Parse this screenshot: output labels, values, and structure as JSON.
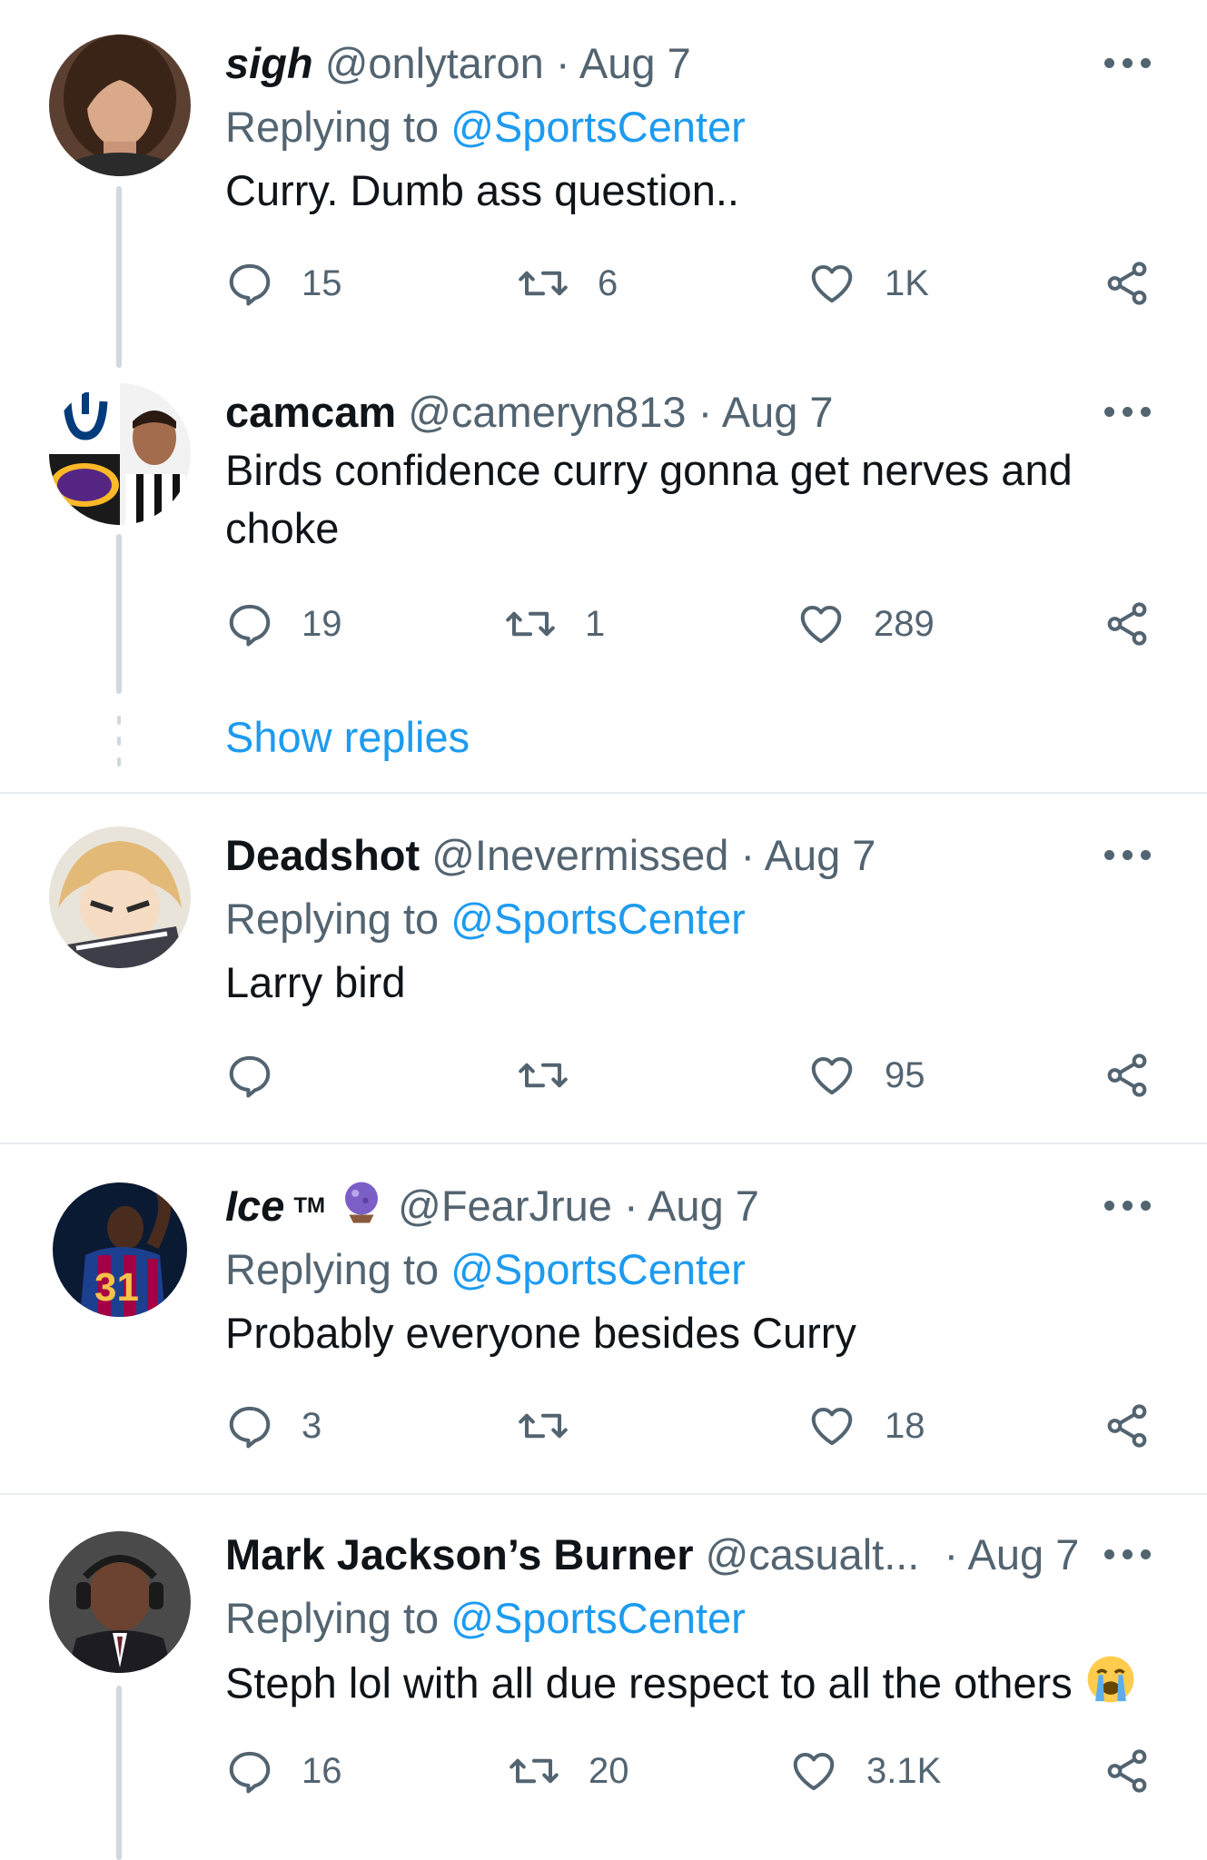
{
  "accent": "#1d9bf0",
  "tweets": [
    {
      "name": "sigh",
      "handle": "@onlytaron",
      "date": "· Aug 7",
      "replying_label": "Replying to",
      "replying_to": "@SportsCenter",
      "text": "Curry. Dumb ass question..",
      "replies": "15",
      "retweets": "6",
      "likes": "1K"
    },
    {
      "name": "camcam",
      "handle": "@cameryn813",
      "date": "· Aug 7",
      "text": "Birds confidence curry gonna get nerves and choke",
      "replies": "19",
      "retweets": "1",
      "likes": "289",
      "show_replies": "Show replies"
    },
    {
      "name": "Deadshot",
      "handle": "@Inevermissed",
      "date": "· Aug 7",
      "replying_label": "Replying to",
      "replying_to": "@SportsCenter",
      "text": "Larry bird",
      "replies": "",
      "retweets": "",
      "likes": "95"
    },
    {
      "name": "Ice",
      "name_suffix": "TM",
      "handle": "@FearJrue",
      "date": "· Aug 7",
      "replying_label": "Replying to",
      "replying_to": "@SportsCenter",
      "text": "Probably everyone besides Curry",
      "replies": "3",
      "retweets": "",
      "likes": "18"
    },
    {
      "name": "Mark Jackson’s Burner",
      "handle": "@casualt...",
      "date": "· Aug 7",
      "replying_label": "Replying to",
      "replying_to": "@SportsCenter",
      "text": "Steph lol with all due respect to all the others",
      "replies": "16",
      "retweets": "20",
      "likes": "3.1K"
    }
  ]
}
